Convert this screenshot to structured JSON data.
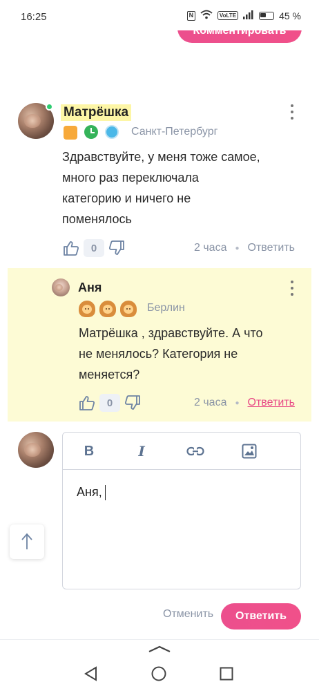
{
  "status_bar": {
    "time": "16:25",
    "volte": "VoLTE",
    "battery_percent": "45 %"
  },
  "top_button": {
    "label": "Комментировать"
  },
  "comment": {
    "username": "Матрёшка",
    "city": "Санкт-Петербург",
    "text_lines": [
      "Здравствуйте, у меня тоже самое,",
      "много раз переключала",
      "категорию и ничего не",
      "поменялось"
    ],
    "votes": "0",
    "time": "2 часа",
    "reply_label": "Ответить",
    "online_color": "#2ecc71"
  },
  "reply": {
    "username": "Аня",
    "city": "Берлин",
    "text_lines": [
      "Матрёшка , здравствуйте. А что",
      "не менялось? Категория не",
      "меняется?"
    ],
    "votes": "0",
    "time": "2 часа",
    "reply_label": "Ответить",
    "highlight_color": "#fdfbd5"
  },
  "editor": {
    "toolbar": [
      "bold-icon",
      "italic-icon",
      "link-icon",
      "image-icon"
    ],
    "bold_glyph": "B",
    "italic_glyph": "I",
    "text": "Аня,"
  },
  "actions": {
    "cancel_label": "Отменить",
    "submit_label": "Ответить"
  },
  "colors": {
    "accent": "#ec4f8d",
    "muted": "#8a94a6"
  }
}
